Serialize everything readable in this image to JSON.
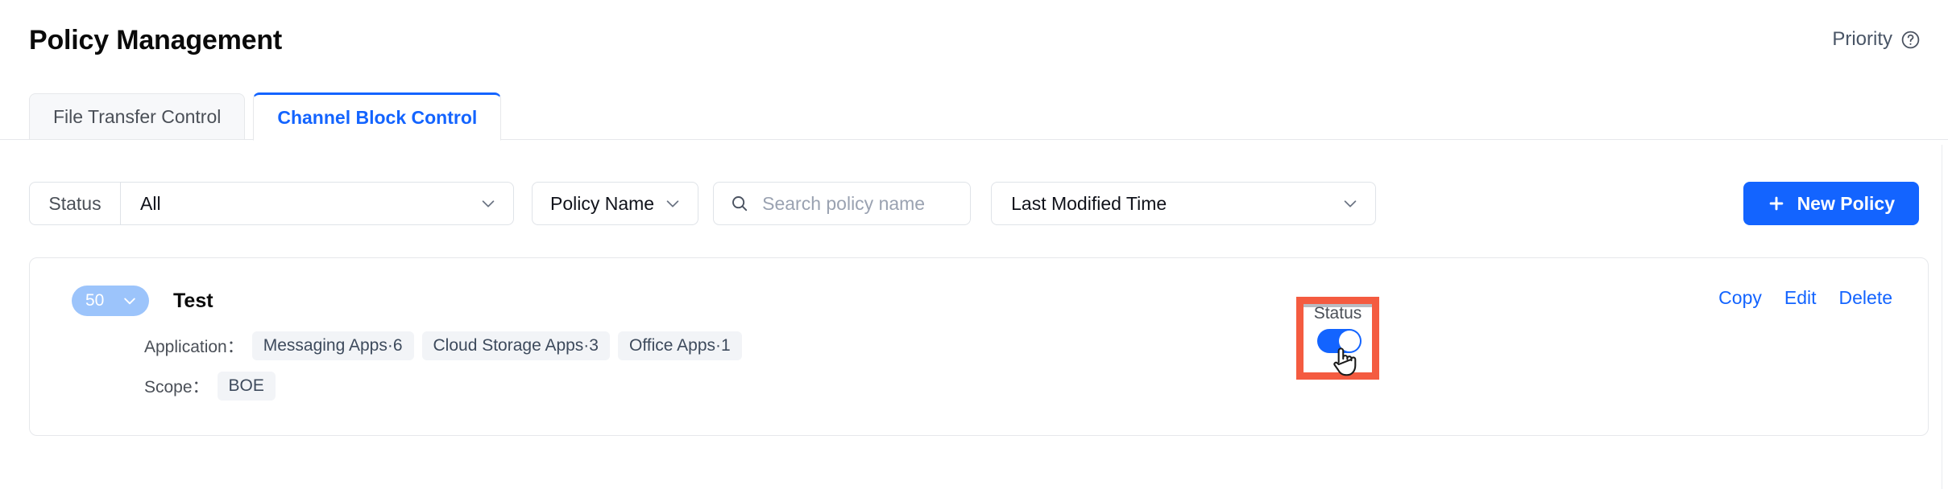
{
  "header": {
    "title": "Policy Management",
    "priority_label": "Priority",
    "help_icon": "question-circle-icon"
  },
  "tabs": [
    {
      "label": "File Transfer Control",
      "active": false
    },
    {
      "label": "Channel Block Control",
      "active": true
    }
  ],
  "filters": {
    "status": {
      "label": "Status",
      "value": "All",
      "chevron_icon": "chevron-down-icon"
    },
    "policy_name_select": {
      "value": "Policy Name",
      "chevron_icon": "chevron-down-icon"
    },
    "search": {
      "icon": "search-icon",
      "placeholder": "Search policy name",
      "value": ""
    },
    "sort": {
      "value": "Last Modified Time",
      "chevron_icon": "chevron-down-icon"
    },
    "new_policy_button": {
      "label": "New Policy",
      "icon": "plus-icon"
    }
  },
  "policy_card": {
    "priority": {
      "value": "50",
      "chevron_icon": "chevron-down-icon"
    },
    "name": "Test",
    "application_label": "Application：",
    "application_tags": [
      "Messaging Apps·6",
      "Cloud Storage Apps·3",
      "Office Apps·1"
    ],
    "scope_label": "Scope：",
    "scope_tags": [
      "BOE"
    ],
    "status": {
      "label": "Status",
      "enabled": true,
      "toggle_icon": "toggle-on-icon",
      "cursor_icon": "hand-pointer-icon",
      "highlighted": true
    },
    "actions": [
      {
        "label": "Copy"
      },
      {
        "label": "Edit"
      },
      {
        "label": "Delete"
      }
    ]
  },
  "colors": {
    "accent_blue": "#1364ff",
    "highlight_red": "#f45b40",
    "priority_badge_blue": "#9cc4fb",
    "tag_background": "#f2f4f7",
    "border_gray": "#e6e8eb"
  }
}
